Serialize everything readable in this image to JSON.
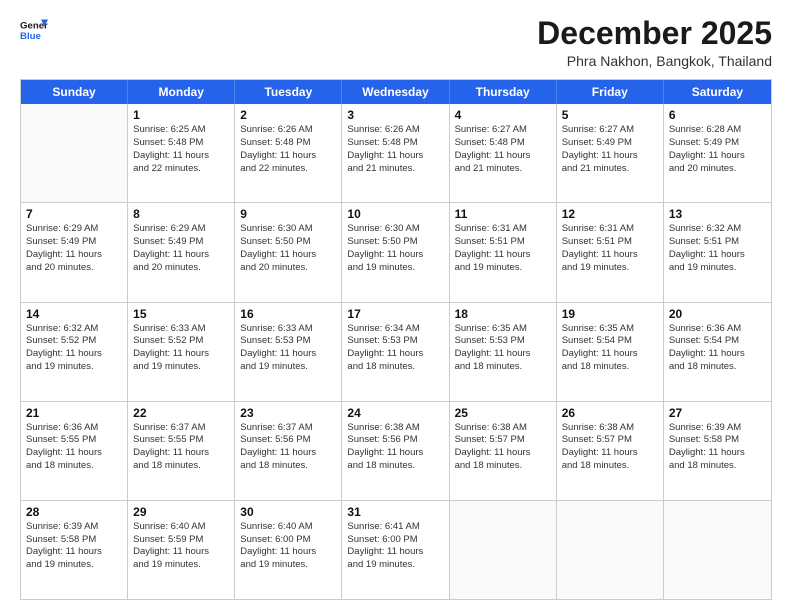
{
  "logo": {
    "text_general": "General",
    "text_blue": "Blue"
  },
  "header": {
    "title": "December 2025",
    "location": "Phra Nakhon, Bangkok, Thailand"
  },
  "weekdays": [
    "Sunday",
    "Monday",
    "Tuesday",
    "Wednesday",
    "Thursday",
    "Friday",
    "Saturday"
  ],
  "rows": [
    [
      {
        "day": "",
        "lines": []
      },
      {
        "day": "1",
        "lines": [
          "Sunrise: 6:25 AM",
          "Sunset: 5:48 PM",
          "Daylight: 11 hours",
          "and 22 minutes."
        ]
      },
      {
        "day": "2",
        "lines": [
          "Sunrise: 6:26 AM",
          "Sunset: 5:48 PM",
          "Daylight: 11 hours",
          "and 22 minutes."
        ]
      },
      {
        "day": "3",
        "lines": [
          "Sunrise: 6:26 AM",
          "Sunset: 5:48 PM",
          "Daylight: 11 hours",
          "and 21 minutes."
        ]
      },
      {
        "day": "4",
        "lines": [
          "Sunrise: 6:27 AM",
          "Sunset: 5:48 PM",
          "Daylight: 11 hours",
          "and 21 minutes."
        ]
      },
      {
        "day": "5",
        "lines": [
          "Sunrise: 6:27 AM",
          "Sunset: 5:49 PM",
          "Daylight: 11 hours",
          "and 21 minutes."
        ]
      },
      {
        "day": "6",
        "lines": [
          "Sunrise: 6:28 AM",
          "Sunset: 5:49 PM",
          "Daylight: 11 hours",
          "and 20 minutes."
        ]
      }
    ],
    [
      {
        "day": "7",
        "lines": [
          "Sunrise: 6:29 AM",
          "Sunset: 5:49 PM",
          "Daylight: 11 hours",
          "and 20 minutes."
        ]
      },
      {
        "day": "8",
        "lines": [
          "Sunrise: 6:29 AM",
          "Sunset: 5:49 PM",
          "Daylight: 11 hours",
          "and 20 minutes."
        ]
      },
      {
        "day": "9",
        "lines": [
          "Sunrise: 6:30 AM",
          "Sunset: 5:50 PM",
          "Daylight: 11 hours",
          "and 20 minutes."
        ]
      },
      {
        "day": "10",
        "lines": [
          "Sunrise: 6:30 AM",
          "Sunset: 5:50 PM",
          "Daylight: 11 hours",
          "and 19 minutes."
        ]
      },
      {
        "day": "11",
        "lines": [
          "Sunrise: 6:31 AM",
          "Sunset: 5:51 PM",
          "Daylight: 11 hours",
          "and 19 minutes."
        ]
      },
      {
        "day": "12",
        "lines": [
          "Sunrise: 6:31 AM",
          "Sunset: 5:51 PM",
          "Daylight: 11 hours",
          "and 19 minutes."
        ]
      },
      {
        "day": "13",
        "lines": [
          "Sunrise: 6:32 AM",
          "Sunset: 5:51 PM",
          "Daylight: 11 hours",
          "and 19 minutes."
        ]
      }
    ],
    [
      {
        "day": "14",
        "lines": [
          "Sunrise: 6:32 AM",
          "Sunset: 5:52 PM",
          "Daylight: 11 hours",
          "and 19 minutes."
        ]
      },
      {
        "day": "15",
        "lines": [
          "Sunrise: 6:33 AM",
          "Sunset: 5:52 PM",
          "Daylight: 11 hours",
          "and 19 minutes."
        ]
      },
      {
        "day": "16",
        "lines": [
          "Sunrise: 6:33 AM",
          "Sunset: 5:53 PM",
          "Daylight: 11 hours",
          "and 19 minutes."
        ]
      },
      {
        "day": "17",
        "lines": [
          "Sunrise: 6:34 AM",
          "Sunset: 5:53 PM",
          "Daylight: 11 hours",
          "and 18 minutes."
        ]
      },
      {
        "day": "18",
        "lines": [
          "Sunrise: 6:35 AM",
          "Sunset: 5:53 PM",
          "Daylight: 11 hours",
          "and 18 minutes."
        ]
      },
      {
        "day": "19",
        "lines": [
          "Sunrise: 6:35 AM",
          "Sunset: 5:54 PM",
          "Daylight: 11 hours",
          "and 18 minutes."
        ]
      },
      {
        "day": "20",
        "lines": [
          "Sunrise: 6:36 AM",
          "Sunset: 5:54 PM",
          "Daylight: 11 hours",
          "and 18 minutes."
        ]
      }
    ],
    [
      {
        "day": "21",
        "lines": [
          "Sunrise: 6:36 AM",
          "Sunset: 5:55 PM",
          "Daylight: 11 hours",
          "and 18 minutes."
        ]
      },
      {
        "day": "22",
        "lines": [
          "Sunrise: 6:37 AM",
          "Sunset: 5:55 PM",
          "Daylight: 11 hours",
          "and 18 minutes."
        ]
      },
      {
        "day": "23",
        "lines": [
          "Sunrise: 6:37 AM",
          "Sunset: 5:56 PM",
          "Daylight: 11 hours",
          "and 18 minutes."
        ]
      },
      {
        "day": "24",
        "lines": [
          "Sunrise: 6:38 AM",
          "Sunset: 5:56 PM",
          "Daylight: 11 hours",
          "and 18 minutes."
        ]
      },
      {
        "day": "25",
        "lines": [
          "Sunrise: 6:38 AM",
          "Sunset: 5:57 PM",
          "Daylight: 11 hours",
          "and 18 minutes."
        ]
      },
      {
        "day": "26",
        "lines": [
          "Sunrise: 6:38 AM",
          "Sunset: 5:57 PM",
          "Daylight: 11 hours",
          "and 18 minutes."
        ]
      },
      {
        "day": "27",
        "lines": [
          "Sunrise: 6:39 AM",
          "Sunset: 5:58 PM",
          "Daylight: 11 hours",
          "and 18 minutes."
        ]
      }
    ],
    [
      {
        "day": "28",
        "lines": [
          "Sunrise: 6:39 AM",
          "Sunset: 5:58 PM",
          "Daylight: 11 hours",
          "and 19 minutes."
        ]
      },
      {
        "day": "29",
        "lines": [
          "Sunrise: 6:40 AM",
          "Sunset: 5:59 PM",
          "Daylight: 11 hours",
          "and 19 minutes."
        ]
      },
      {
        "day": "30",
        "lines": [
          "Sunrise: 6:40 AM",
          "Sunset: 6:00 PM",
          "Daylight: 11 hours",
          "and 19 minutes."
        ]
      },
      {
        "day": "31",
        "lines": [
          "Sunrise: 6:41 AM",
          "Sunset: 6:00 PM",
          "Daylight: 11 hours",
          "and 19 minutes."
        ]
      },
      {
        "day": "",
        "lines": []
      },
      {
        "day": "",
        "lines": []
      },
      {
        "day": "",
        "lines": []
      }
    ]
  ]
}
